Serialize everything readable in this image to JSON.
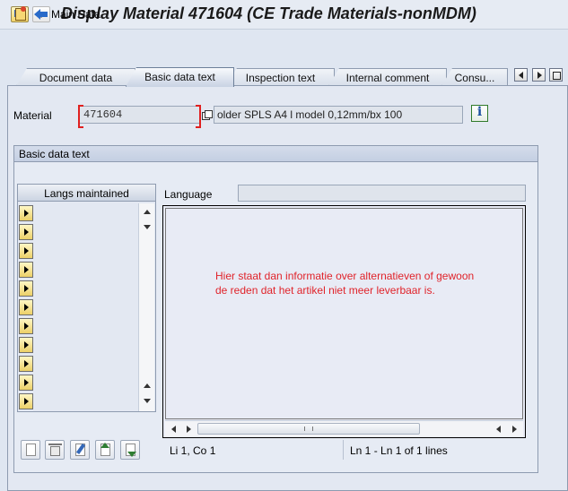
{
  "window": {
    "title": "Display Material 471604 (CE Trade Materials-nonMDM)"
  },
  "toolbar": {
    "main_data_label": "Main Data"
  },
  "tabs": [
    {
      "label": "Document data",
      "active": false
    },
    {
      "label": "Basic data text",
      "active": true
    },
    {
      "label": "Inspection text",
      "active": false
    },
    {
      "label": "Internal comment",
      "active": false
    },
    {
      "label": "Consu...",
      "active": false
    }
  ],
  "material": {
    "label": "Material",
    "value": "471604",
    "description": "older SPLS A4 l model 0,12mm/bx 100"
  },
  "group": {
    "title": "Basic data text"
  },
  "langs_table": {
    "header": "Langs maintained",
    "row_count": 11
  },
  "language": {
    "label": "Language",
    "value": ""
  },
  "editor": {
    "text_line1": "Hier staat dan informatie over alternatieven of gewoon",
    "text_line2": "de reden dat het artikel niet meer leverbaar is."
  },
  "status": {
    "cursor": "Li 1, Co 1",
    "lines": "Ln 1 - Ln 1 of 1 lines"
  },
  "colors": {
    "editor_text": "#e0232a",
    "background": "#dfe6f1",
    "required_marker": "#e02020"
  }
}
